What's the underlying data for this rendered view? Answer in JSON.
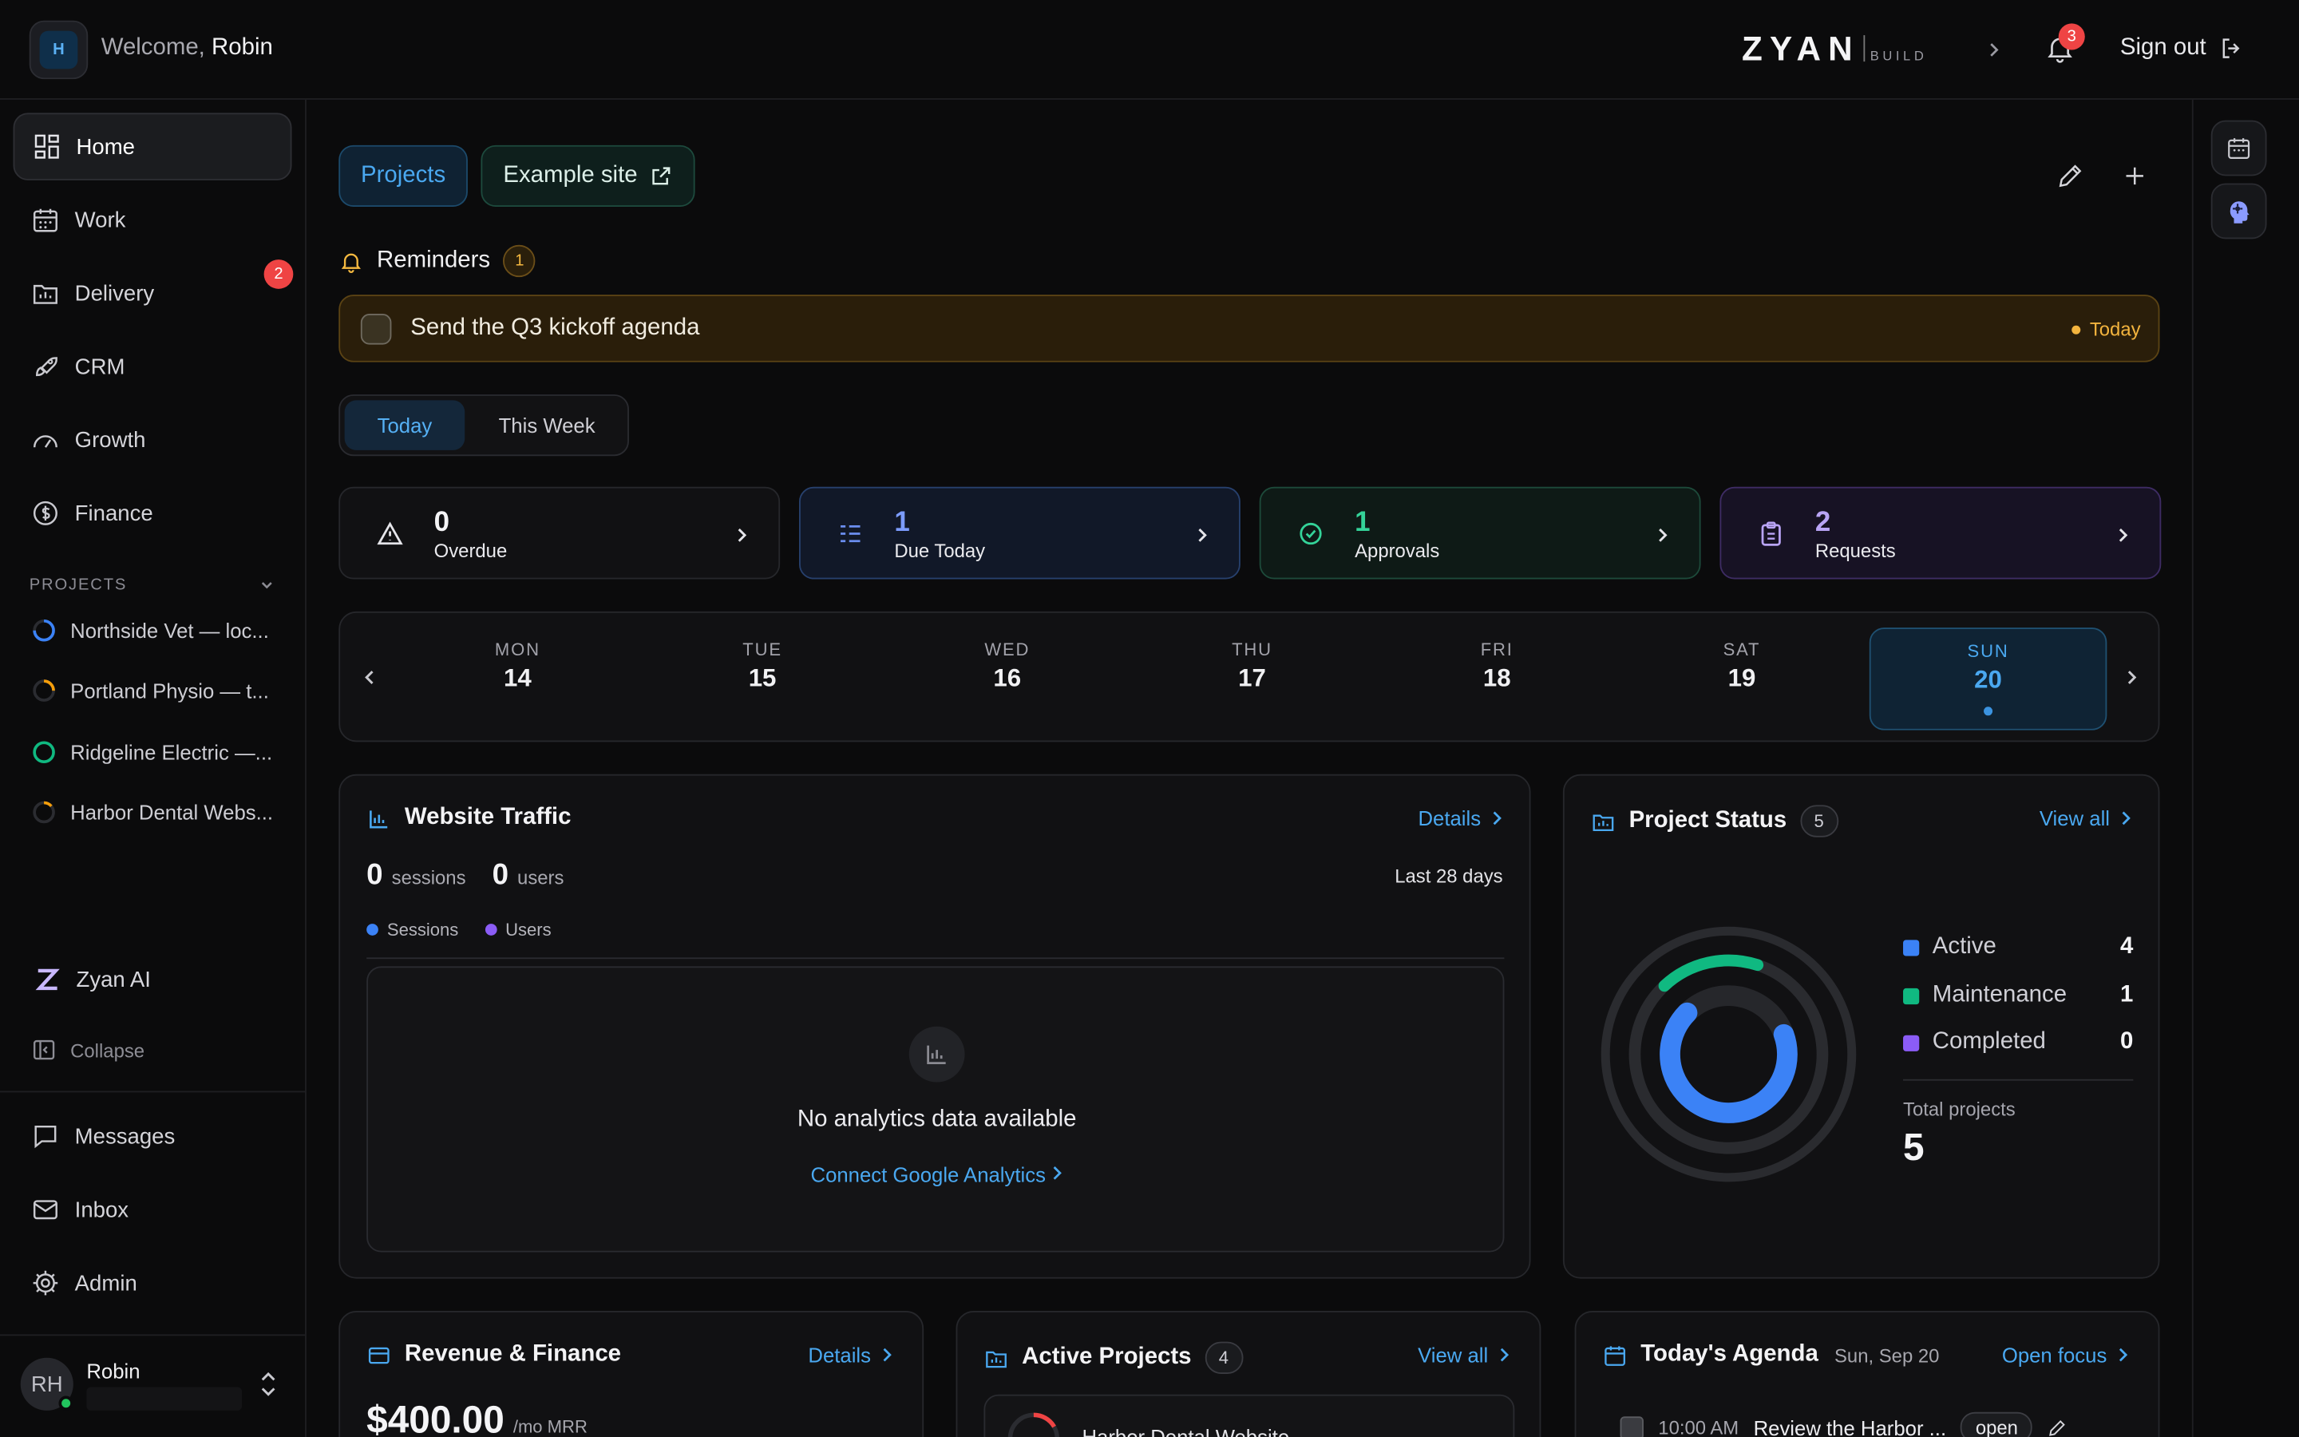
{
  "header": {
    "workspace_initial": "H",
    "welcome_prefix": "Welcome,",
    "welcome_name": "Robin",
    "brand": "ZYAN",
    "brand_sub": "BUILD",
    "notification_count": "3",
    "signout_label": "Sign out"
  },
  "sidebar": {
    "items": [
      {
        "label": "Home",
        "icon": "grid-icon"
      },
      {
        "label": "Work",
        "icon": "calendar-icon"
      },
      {
        "label": "Delivery",
        "icon": "folder-chart-icon",
        "badge": "2"
      },
      {
        "label": "CRM",
        "icon": "rocket-icon"
      },
      {
        "label": "Growth",
        "icon": "gauge-icon"
      },
      {
        "label": "Finance",
        "icon": "dollar-icon"
      }
    ],
    "projects_heading": "PROJECTS",
    "projects": [
      {
        "label": "Northside Vet — loc...",
        "color": "#3b82f6"
      },
      {
        "label": "Portland Physio — t...",
        "color": "#f59e0b"
      },
      {
        "label": "Ridgeline Electric —...",
        "color": "#10b981"
      },
      {
        "label": "Harbor Dental Webs...",
        "color": "#f59e0b"
      }
    ],
    "ai_label": "Zyan AI",
    "collapse_label": "Collapse",
    "bottom_items": [
      {
        "label": "Messages",
        "icon": "message-icon"
      },
      {
        "label": "Inbox",
        "icon": "mail-icon"
      },
      {
        "label": "Admin",
        "icon": "gear-icon"
      }
    ],
    "user": {
      "initials": "RH",
      "name": "Robin"
    }
  },
  "main": {
    "tab_projects": "Projects",
    "tab_example": "Example site",
    "reminders": {
      "title": "Reminders",
      "count": "1",
      "item_text": "Send the Q3 kickoff agenda",
      "item_when": "Today"
    },
    "segment": {
      "today": "Today",
      "week": "This Week"
    },
    "stats": [
      {
        "value": "0",
        "label": "Overdue"
      },
      {
        "value": "1",
        "label": "Due Today"
      },
      {
        "value": "1",
        "label": "Approvals"
      },
      {
        "value": "2",
        "label": "Requests"
      }
    ],
    "calendar": [
      {
        "dow": "MON",
        "day": "14"
      },
      {
        "dow": "TUE",
        "day": "15"
      },
      {
        "dow": "WED",
        "day": "16"
      },
      {
        "dow": "THU",
        "day": "17"
      },
      {
        "dow": "FRI",
        "day": "18"
      },
      {
        "dow": "SAT",
        "day": "19"
      },
      {
        "dow": "SUN",
        "day": "20",
        "selected": true
      }
    ],
    "traffic": {
      "title": "Website Traffic",
      "link": "Details",
      "sessions_value": "0",
      "sessions_label": "sessions",
      "users_value": "0",
      "users_label": "users",
      "range": "Last 28 days",
      "legend_sessions": "Sessions",
      "legend_users": "Users",
      "empty_message": "No analytics data available",
      "cta": "Connect Google Analytics",
      "color_sessions": "#3b82f6",
      "color_users": "#8b5cf6"
    },
    "project_status": {
      "title": "Project Status",
      "count": "5",
      "link": "View all",
      "rows": [
        {
          "label": "Active",
          "value": "4",
          "color": "#3b82f6"
        },
        {
          "label": "Maintenance",
          "value": "1",
          "color": "#10b981"
        },
        {
          "label": "Completed",
          "value": "0",
          "color": "#8b5cf6"
        }
      ],
      "total_label": "Total projects",
      "total_value": "5"
    },
    "revenue": {
      "title": "Revenue & Finance",
      "link": "Details",
      "value": "$400.00",
      "unit": "/mo MRR"
    },
    "active_projects": {
      "title": "Active Projects",
      "count": "4",
      "link": "View all",
      "first_item": "Harbor Dental Website"
    },
    "agenda": {
      "title": "Today's Agenda",
      "date": "Sun, Sep 20",
      "link": "Open focus",
      "item_time": "10:00 AM",
      "item_text": "Review the Harbor ...",
      "item_tag": "open"
    }
  },
  "chart_data": {
    "type": "pie",
    "categories": [
      "Active",
      "Maintenance",
      "Completed"
    ],
    "values": [
      4,
      1,
      0
    ],
    "total": 5
  }
}
